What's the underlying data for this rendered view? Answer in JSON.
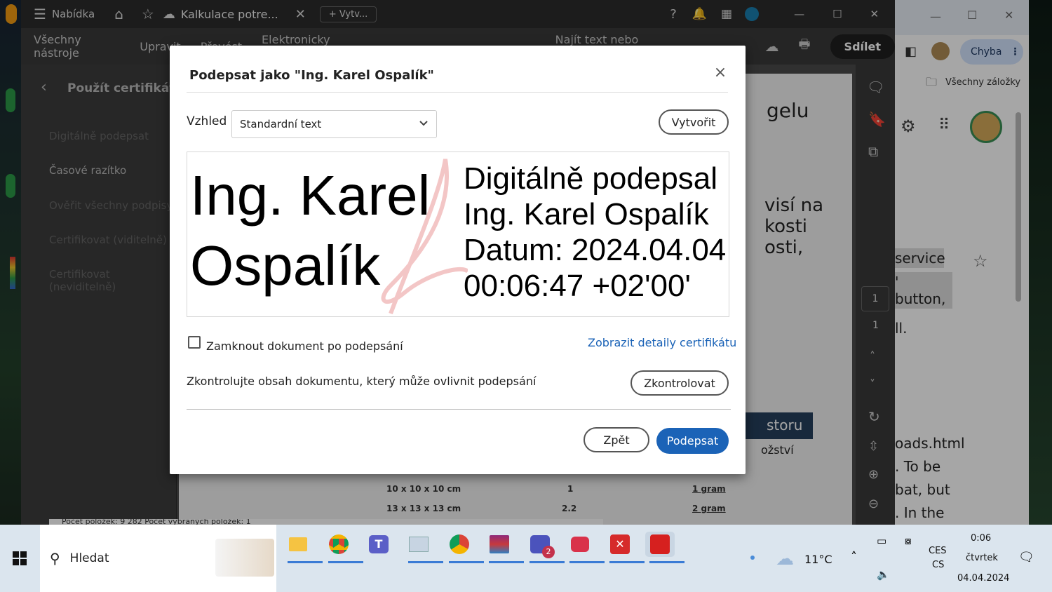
{
  "acrobat": {
    "menu_label": "Nabídka",
    "tab_title": "Kalkulace potre...",
    "new_tab_label": "Vytv...",
    "toolbar_items": [
      "Všechny nástroje",
      "Upravit",
      "Převést",
      "Elektronicky podepsat"
    ],
    "search_placeholder": "Najít text nebo nástroje",
    "share_label": "Sdílet",
    "panel_title": "Použít certifikát",
    "sidebar_items": [
      "Digitálně podepsat",
      "Časové razítko",
      "Ověřit všechny podpisy",
      "Certifikovat (viditelně)",
      "Certifikovat (neviditelně)"
    ],
    "page_numbers": [
      "1",
      "1"
    ],
    "status_bar": "Počet položek: 9 282    Počet vybraných položek: 1"
  },
  "document": {
    "fragments": [
      "gelu",
      "visí na",
      "kosti",
      "osti,",
      "storu",
      "ožství"
    ],
    "table_rows": [
      {
        "size": "10 x 10 x 10 cm",
        "qty": "1",
        "weight": "1 gram"
      },
      {
        "size": "13 x 13 x 13 cm",
        "qty": "2.2",
        "weight": "2 gram"
      }
    ]
  },
  "chrome": {
    "profile_status": "Chyba",
    "bookmarks_label": "Všechny záložky",
    "text_fragments": [
      "service",
      "' button,",
      "ll.",
      "oads.html",
      ". To be",
      "bat, but",
      ". In the"
    ]
  },
  "dialog": {
    "title": "Podepsat jako \"Ing. Karel Ospalík\"",
    "appearance_label": "Vzhled",
    "appearance_value": "Standardní text",
    "create_button": "Vytvořit",
    "signature_name_line1": "Ing. Karel",
    "signature_name_line2": "Ospalík",
    "details": [
      "Digitálně podepsal",
      "Ing. Karel Ospalík",
      "Datum: 2024.04.04",
      "00:06:47 +02'00'"
    ],
    "lock_label": "Zamknout dokument po podepsání",
    "cert_link": "Zobrazit detaily certifikátu",
    "review_text": "Zkontrolujte obsah dokumentu, který může ovlivnit podepsání",
    "review_button": "Zkontrolovat",
    "back_button": "Zpět",
    "sign_button": "Podepsat"
  },
  "taskbar": {
    "search_label": "Hledat",
    "temperature": "11°C",
    "lang_line1": "CES",
    "lang_line2": "CS",
    "time": "0:06",
    "day": "čtvrtek",
    "date": "04.04.2024",
    "teams_badge": "2"
  },
  "colors": {
    "accent": "#1b63b7",
    "share_button": "#1f1f1f",
    "taskbar": "#dbe5ee"
  }
}
